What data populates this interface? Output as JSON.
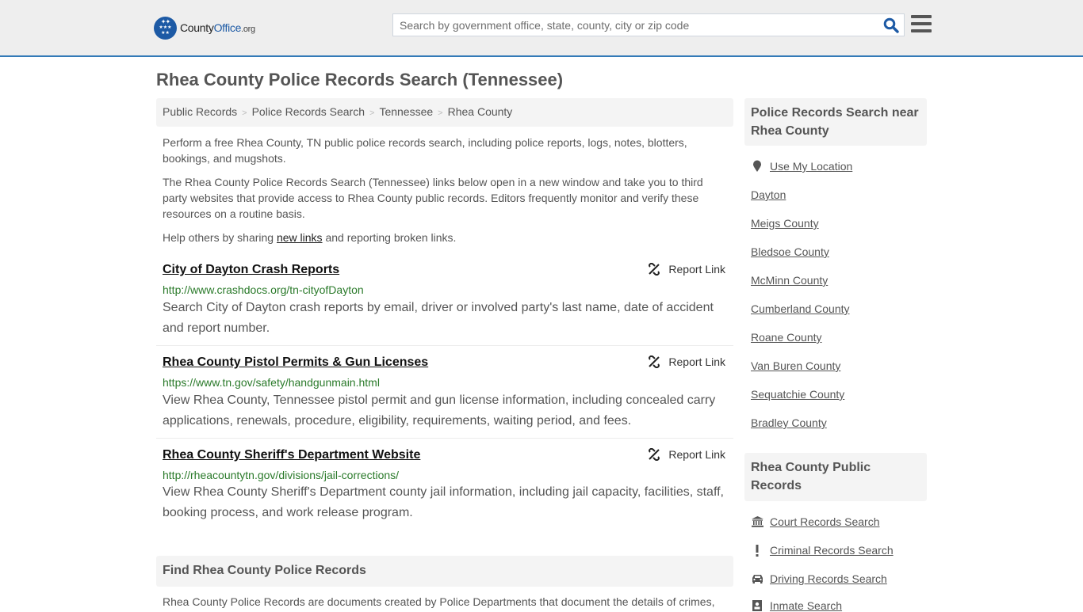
{
  "header": {
    "logo": {
      "county": "County",
      "office": "Office",
      "org": ".org"
    },
    "search_placeholder": "Search by government office, state, county, city or zip code",
    "brand_color": "#1d5aa5",
    "accent_color": "#337ab7"
  },
  "page_title": "Rhea County Police Records Search (Tennessee)",
  "breadcrumb": [
    "Public Records",
    "Police Records Search",
    "Tennessee",
    "Rhea County"
  ],
  "intro": {
    "p1": "Perform a free Rhea County, TN public police records search, including police reports, logs, notes, blotters, bookings, and mugshots.",
    "p2": "The Rhea County Police Records Search (Tennessee) links below open in a new window and take you to third party websites that provide access to Rhea County public records. Editors frequently monitor and verify these resources on a routine basis.",
    "p3_before": "Help others by sharing ",
    "p3_link": "new links",
    "p3_after": " and reporting broken links."
  },
  "results": [
    {
      "title": "City of Dayton Crash Reports",
      "url": "http://www.crashdocs.org/tn-cityofDayton",
      "description": "Search City of Dayton crash reports by email, driver or involved party's last name, date of accident and report number.",
      "report_label": "Report Link"
    },
    {
      "title": "Rhea County Pistol Permits & Gun Licenses",
      "url": "https://www.tn.gov/safety/handgunmain.html",
      "description": "View Rhea County, Tennessee pistol permit and gun license information, including concealed carry applications, renewals, procedure, eligibility, requirements, waiting period, and fees.",
      "report_label": "Report Link"
    },
    {
      "title": "Rhea County Sheriff's Department Website",
      "url": "http://rheacountytn.gov/divisions/jail-corrections/",
      "description": "View Rhea County Sheriff's Department county jail information, including jail capacity, facilities, staff, booking process, and work release program.",
      "report_label": "Report Link"
    }
  ],
  "find_section": {
    "title": "Find Rhea County Police Records",
    "text": "Rhea County Police Records are documents created by Police Departments that document the details of crimes,"
  },
  "sidebar": {
    "nearby_title": "Police Records Search near Rhea County",
    "use_location": "Use My Location",
    "nearby": [
      "Dayton",
      "Meigs County",
      "Bledsoe County",
      "McMinn County",
      "Cumberland County",
      "Roane County",
      "Van Buren County",
      "Sequatchie County",
      "Bradley County"
    ],
    "public_records_title": "Rhea County Public Records",
    "public_records": [
      {
        "label": "Court Records Search",
        "icon": "courthouse-icon"
      },
      {
        "label": "Criminal Records Search",
        "icon": "exclamation-icon"
      },
      {
        "label": "Driving Records Search",
        "icon": "car-icon"
      },
      {
        "label": "Inmate Search",
        "icon": "inmate-icon"
      }
    ]
  }
}
